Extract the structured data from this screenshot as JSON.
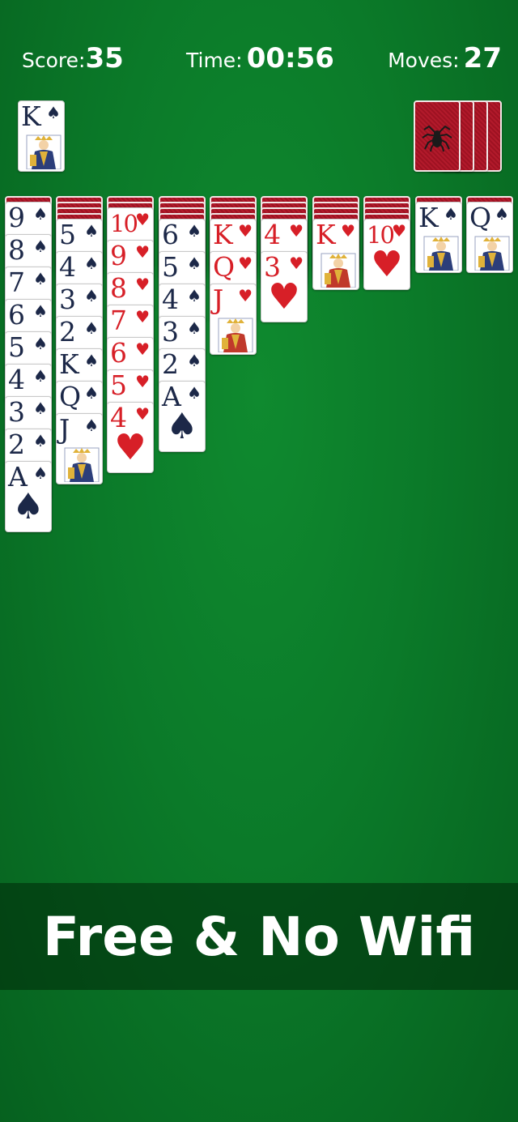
{
  "hud": {
    "score_label": "Score:",
    "score_value": "35",
    "time_label": "Time:",
    "time_value": "00:56",
    "moves_label": "Moves:",
    "moves_value": "27"
  },
  "foundation": {
    "completed": [
      {
        "rank": "K",
        "suit": "♠",
        "color": "black"
      }
    ]
  },
  "stock": {
    "piles_remaining": 4,
    "back_icon": "spider-icon"
  },
  "tableau": [
    {
      "hidden": 1,
      "cards": [
        {
          "rank": "9",
          "suit": "♠",
          "color": "black"
        },
        {
          "rank": "8",
          "suit": "♠",
          "color": "black"
        },
        {
          "rank": "7",
          "suit": "♠",
          "color": "black"
        },
        {
          "rank": "6",
          "suit": "♠",
          "color": "black"
        },
        {
          "rank": "5",
          "suit": "♠",
          "color": "black"
        },
        {
          "rank": "4",
          "suit": "♠",
          "color": "black"
        },
        {
          "rank": "3",
          "suit": "♠",
          "color": "black"
        },
        {
          "rank": "2",
          "suit": "♠",
          "color": "black"
        },
        {
          "rank": "A",
          "suit": "♠",
          "color": "black"
        }
      ]
    },
    {
      "hidden": 4,
      "cards": [
        {
          "rank": "5",
          "suit": "♠",
          "color": "black"
        },
        {
          "rank": "4",
          "suit": "♠",
          "color": "black"
        },
        {
          "rank": "3",
          "suit": "♠",
          "color": "black"
        },
        {
          "rank": "2",
          "suit": "♠",
          "color": "black"
        },
        {
          "rank": "K",
          "suit": "♠",
          "color": "black"
        },
        {
          "rank": "Q",
          "suit": "♠",
          "color": "black"
        },
        {
          "rank": "J",
          "suit": "♠",
          "color": "black"
        }
      ]
    },
    {
      "hidden": 2,
      "cards": [
        {
          "rank": "10",
          "suit": "♥",
          "color": "red"
        },
        {
          "rank": "9",
          "suit": "♥",
          "color": "red"
        },
        {
          "rank": "8",
          "suit": "♥",
          "color": "red"
        },
        {
          "rank": "7",
          "suit": "♥",
          "color": "red"
        },
        {
          "rank": "6",
          "suit": "♥",
          "color": "red"
        },
        {
          "rank": "5",
          "suit": "♥",
          "color": "red"
        },
        {
          "rank": "4",
          "suit": "♥",
          "color": "red"
        }
      ]
    },
    {
      "hidden": 4,
      "cards": [
        {
          "rank": "6",
          "suit": "♠",
          "color": "black"
        },
        {
          "rank": "5",
          "suit": "♠",
          "color": "black"
        },
        {
          "rank": "4",
          "suit": "♠",
          "color": "black"
        },
        {
          "rank": "3",
          "suit": "♠",
          "color": "black"
        },
        {
          "rank": "2",
          "suit": "♠",
          "color": "black"
        },
        {
          "rank": "A",
          "suit": "♠",
          "color": "black"
        }
      ]
    },
    {
      "hidden": 4,
      "cards": [
        {
          "rank": "K",
          "suit": "♥",
          "color": "red"
        },
        {
          "rank": "Q",
          "suit": "♥",
          "color": "red"
        },
        {
          "rank": "J",
          "suit": "♥",
          "color": "red"
        }
      ]
    },
    {
      "hidden": 4,
      "cards": [
        {
          "rank": "4",
          "suit": "♥",
          "color": "red"
        },
        {
          "rank": "3",
          "suit": "♥",
          "color": "red"
        }
      ]
    },
    {
      "hidden": 4,
      "cards": [
        {
          "rank": "K",
          "suit": "♥",
          "color": "red"
        }
      ]
    },
    {
      "hidden": 4,
      "cards": [
        {
          "rank": "10",
          "suit": "♥",
          "color": "red"
        }
      ]
    },
    {
      "hidden": 1,
      "cards": [
        {
          "rank": "K",
          "suit": "♠",
          "color": "black"
        }
      ]
    },
    {
      "hidden": 1,
      "cards": [
        {
          "rank": "Q",
          "suit": "♠",
          "color": "black"
        }
      ]
    }
  ],
  "banner": {
    "text": "Free & No Wifi"
  },
  "colors": {
    "felt": "#0b7a29",
    "card_back": "#b21a2b",
    "red_suit": "#d71f27",
    "black_suit": "#1c2848"
  }
}
